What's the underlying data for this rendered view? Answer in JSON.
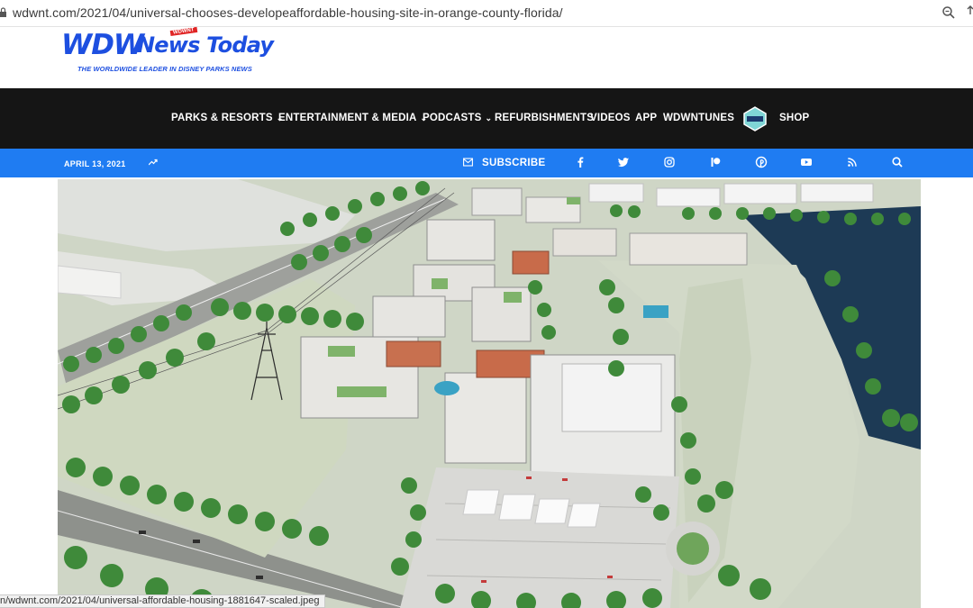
{
  "browser": {
    "url": "wdwnt.com/2021/04/universal-chooses-developeaffordable-housing-site-in-orange-county-florida/",
    "status_link": "n/wdwnt.com/2021/04/universal-affordable-housing-1881647-scaled.jpeg"
  },
  "logo": {
    "brand_left": "WDW",
    "brand_right": "News Today",
    "badge": "WDWNT",
    "tagline": "THE WORLDWIDE LEADER IN DISNEY PARKS NEWS"
  },
  "nav": {
    "items": [
      {
        "label": "PARKS & RESORTS",
        "has_dropdown": true
      },
      {
        "label": "ENTERTAINMENT & MEDIA",
        "has_dropdown": true
      },
      {
        "label": "PODCASTS",
        "has_dropdown": true
      },
      {
        "label": "REFURBISHMENTS",
        "has_dropdown": false
      },
      {
        "label": "VIDEOS",
        "has_dropdown": false
      },
      {
        "label": "APP",
        "has_dropdown": false
      },
      {
        "label": "WDWNTUNES",
        "has_dropdown": false
      },
      {
        "label": "SHOP",
        "has_dropdown": false
      }
    ],
    "chevron": "⌄"
  },
  "subbar": {
    "date": "APRIL 13, 2021",
    "subscribe": "SUBSCRIBE",
    "icons": [
      "trending-icon",
      "mail-icon",
      "facebook-icon",
      "twitter-icon",
      "instagram-icon",
      "patreon-icon",
      "pinterest-icon",
      "youtube-icon",
      "rss-icon",
      "search-icon"
    ]
  },
  "colors": {
    "brand_blue": "#1d4fe0",
    "nav_black": "#151515",
    "bar_blue": "#1f7cf2"
  }
}
